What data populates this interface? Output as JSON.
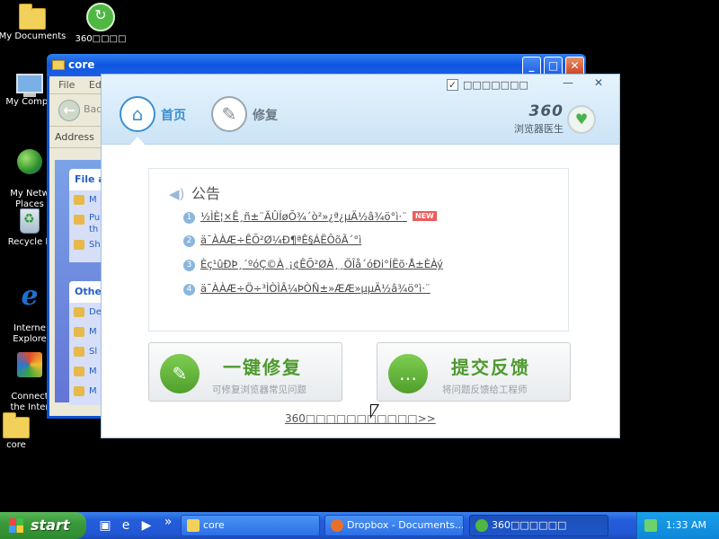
{
  "desktop": {
    "icons": [
      {
        "label": "My Documents",
        "icon": "folder-documents-icon"
      },
      {
        "label": "360□□□□",
        "icon": "360-browser-doctor-icon"
      },
      {
        "label": "My Compu",
        "icon": "my-computer-icon"
      },
      {
        "label": "My Netw\nPlaces",
        "icon": "network-places-icon"
      },
      {
        "label": "Recycle B",
        "icon": "recycle-bin-icon"
      },
      {
        "label": "Interne\nExplore",
        "icon": "internet-explorer-icon"
      },
      {
        "label": "Connect\nthe Inter",
        "icon": "connect-internet-icon"
      },
      {
        "label": "core",
        "icon": "folder-icon"
      }
    ]
  },
  "explorer": {
    "title": "core",
    "menu": [
      "File",
      "Edi"
    ],
    "back_label": "Back",
    "address_label": "Address",
    "panel1_title": "File a",
    "panel1_rows": [
      "M",
      "Pu\nth",
      "Sh"
    ],
    "panel2_title": "Other",
    "panel2_rows": [
      "De",
      "M",
      "Sl",
      "M",
      "M"
    ]
  },
  "app": {
    "tabs": [
      {
        "label": "首页",
        "icon": "home-icon",
        "active": true
      },
      {
        "label": "修复",
        "icon": "wrench-icon",
        "active": false
      }
    ],
    "option_label": "□□□□□□□",
    "option_checked": "✓",
    "minimize": "—",
    "close": "✕",
    "brand_number": "360",
    "brand_name": "浏览器医生",
    "notice": {
      "title": "公告",
      "items": [
        {
          "num": "1",
          "text": "½ÌÈ¦×Ê¸ñ±¨ÃÛÍøÕ¾´ò²»¿ª¿µÄ½â¾ö°ì·¨",
          "badge": "NEW"
        },
        {
          "num": "2",
          "text": "ä¯ÀÀÆ÷ÊÕ²Ø¼Ð¶ªÊ§ÁËÔõÃ´°ì"
        },
        {
          "num": "3",
          "text": "Èç¹ûÐÞ¸´ºóÇ©À¸¡¢ÊÕ²ØÀ¸¸ÖÎå´óÐi°ÍËõ·Å±ÈÀý"
        },
        {
          "num": "4",
          "text": "ä¯ÀÀÆ÷Ö÷³ÌÒÌÂ¼ÞÒÑ±»ÆÆ»µµÄ½â¾ö°ì·¨"
        }
      ]
    },
    "repair_button": {
      "title": "一键修复",
      "desc": "可修复浏览器常见问题",
      "icon": "wrench-icon"
    },
    "feedback_button": {
      "title": "提交反馈",
      "desc": "将问题反馈给工程师",
      "icon": "chat-icon"
    },
    "footer_link": "360□□□□□□□□□□□>>"
  },
  "taskbar": {
    "start_label": "start",
    "quicklaunch_more": "»",
    "tasks": [
      {
        "label": "core",
        "active": false
      },
      {
        "label": "Dropbox - Documents...",
        "active": false
      },
      {
        "label": "360□□□□□□",
        "active": true
      }
    ],
    "clock": "1:33 AM"
  }
}
